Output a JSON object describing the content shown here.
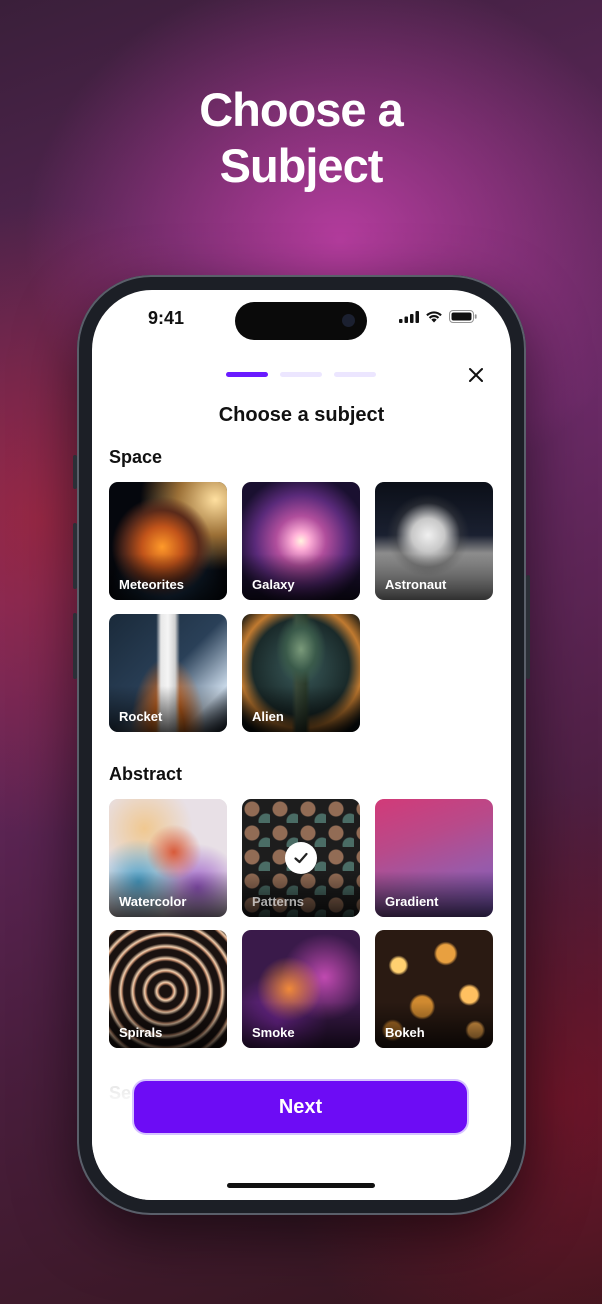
{
  "headline": {
    "line1": "Choose a",
    "line2": "Subject"
  },
  "status_bar": {
    "time": "9:41"
  },
  "progress": {
    "total": 3,
    "current": 1
  },
  "screen_title": "Choose a subject",
  "sections": [
    {
      "title": "Space",
      "items": [
        {
          "label": "Meteorites",
          "icon": "meteorites-image",
          "selected": false
        },
        {
          "label": "Galaxy",
          "icon": "galaxy-image",
          "selected": false
        },
        {
          "label": "Astronaut",
          "icon": "astronaut-image",
          "selected": false
        },
        {
          "label": "Rocket",
          "icon": "rocket-image",
          "selected": false
        },
        {
          "label": "Alien",
          "icon": "alien-image",
          "selected": false
        }
      ]
    },
    {
      "title": "Abstract",
      "items": [
        {
          "label": "Watercolor",
          "icon": "watercolor-image",
          "selected": false
        },
        {
          "label": "Patterns",
          "icon": "patterns-image",
          "selected": true
        },
        {
          "label": "Gradient",
          "icon": "gradient-image",
          "selected": false
        },
        {
          "label": "Spirals",
          "icon": "spirals-image",
          "selected": false
        },
        {
          "label": "Smoke",
          "icon": "smoke-image",
          "selected": false
        },
        {
          "label": "Bokeh",
          "icon": "bokeh-image",
          "selected": false
        }
      ]
    },
    {
      "title": "Se",
      "items": []
    }
  ],
  "next_button": {
    "label": "Next"
  },
  "colors": {
    "accent": "#6d0cf5",
    "progress_active": "#6a1bff",
    "progress_inactive": "#ece6ff"
  }
}
